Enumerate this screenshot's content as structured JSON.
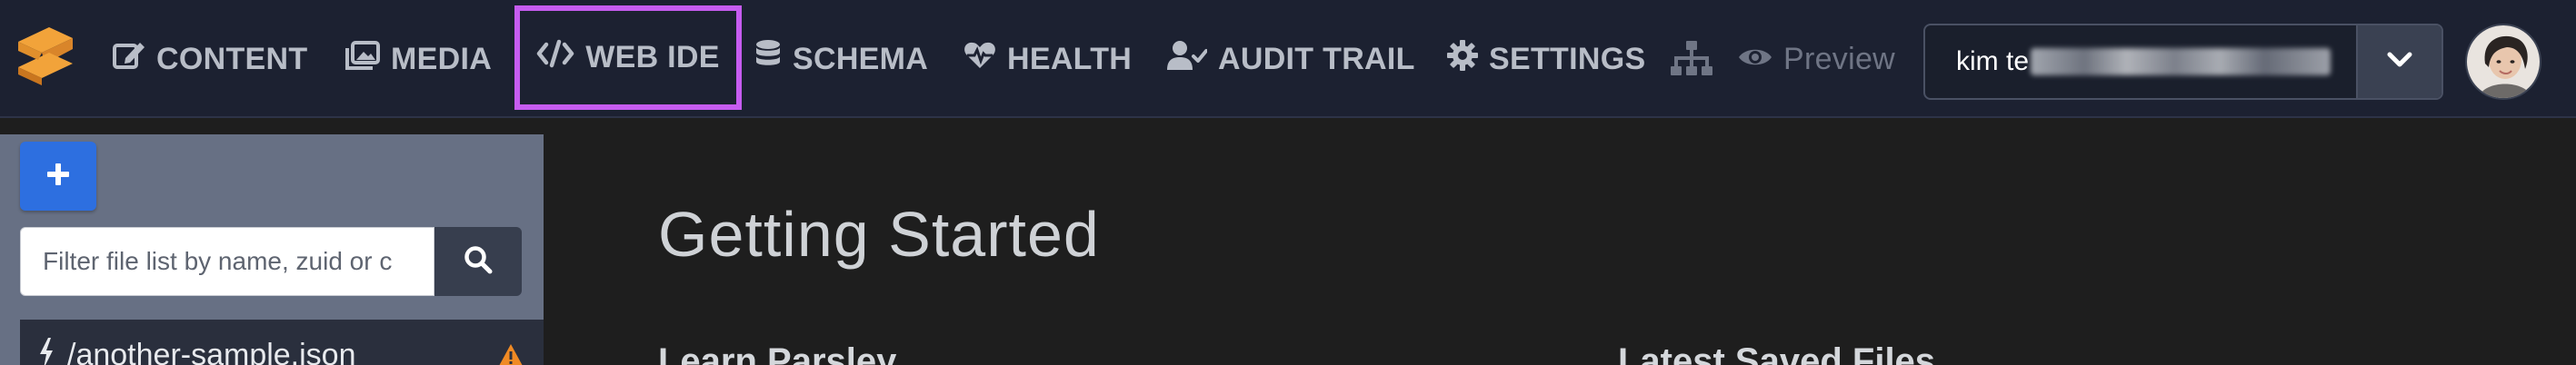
{
  "nav": {
    "items": [
      {
        "label": "CONTENT",
        "icon": "edit-icon"
      },
      {
        "label": "MEDIA",
        "icon": "images-icon"
      },
      {
        "label": "WEB IDE",
        "icon": "code-icon"
      },
      {
        "label": "SCHEMA",
        "icon": "database-icon"
      },
      {
        "label": "HEALTH",
        "icon": "heartbeat-icon"
      },
      {
        "label": "AUDIT TRAIL",
        "icon": "user-check-icon"
      },
      {
        "label": "SETTINGS",
        "icon": "gear-icon"
      }
    ],
    "highlight_color": "#c65cf0",
    "preview_label": "Preview"
  },
  "user": {
    "visible_name": "kim te"
  },
  "sidebar": {
    "add_label": "+",
    "filter_placeholder": "Filter file list by name, zuid or c",
    "files": [
      {
        "name": "/another-sample.json"
      }
    ]
  },
  "main": {
    "title": "Getting Started",
    "sections": [
      "Learn Parsley",
      "Latest Saved Files"
    ]
  },
  "colors": {
    "accent_blue": "#2d6fe0",
    "logo_orange": "#f2a33a",
    "warning_orange": "#f08a24"
  }
}
